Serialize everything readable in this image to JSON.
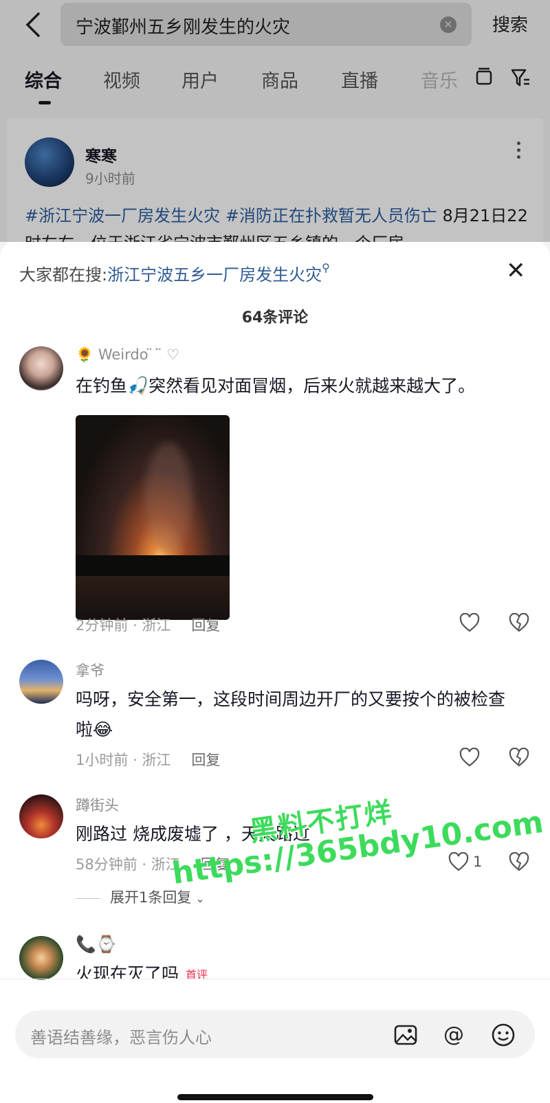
{
  "search": {
    "query": "宁波鄞州五乡刚发生的火灾",
    "button": "搜索"
  },
  "tabs": [
    {
      "label": "综合"
    },
    {
      "label": "视频"
    },
    {
      "label": "用户"
    },
    {
      "label": "商品"
    },
    {
      "label": "直播"
    },
    {
      "label": "音乐"
    }
  ],
  "post": {
    "author": "寒寒",
    "time": "9小时前",
    "tag1": "#浙江宁波一厂房发生火灾",
    "tag2": "#消防正在扑救暂无人员伤亡",
    "text_rest": " 8月21日22时左右，位于浙江省宁波市鄞州区五乡镇的一个厂房"
  },
  "sheet": {
    "hint_prefix": "大家都在搜:",
    "hint_link": "浙江宁波五乡一厂房发生火灾",
    "comment_count": "64条评论"
  },
  "comments": [
    {
      "user": "🌻 Weirdo ̈ ͘ ̈ ♡",
      "text": "在钓鱼🎣突然看见对面冒烟，后来火就越来越大了。",
      "time": "2分钟前 · 浙江",
      "reply": "回复"
    },
    {
      "user": "拿爷",
      "text": "吗呀，安全第一，这段时间周边开厂的又要按个的被检查啦😂",
      "time": "1小时前 · 浙江",
      "reply": "回复"
    },
    {
      "user": "蹲街头",
      "text": "刚路过 烧成废墟了 ，天天路过",
      "time": "58分钟前 · 浙江",
      "reply": "回复",
      "likes": "1",
      "expand": "展开1条回复"
    },
    {
      "user": "📞⌚",
      "text": "火现在灭了吗",
      "badge": "首评"
    }
  ],
  "input": {
    "placeholder": "善语结善缘，恶言伤人心"
  },
  "watermark": {
    "line1": "黑料不打烊",
    "line2": "https://365bdy10.com"
  }
}
